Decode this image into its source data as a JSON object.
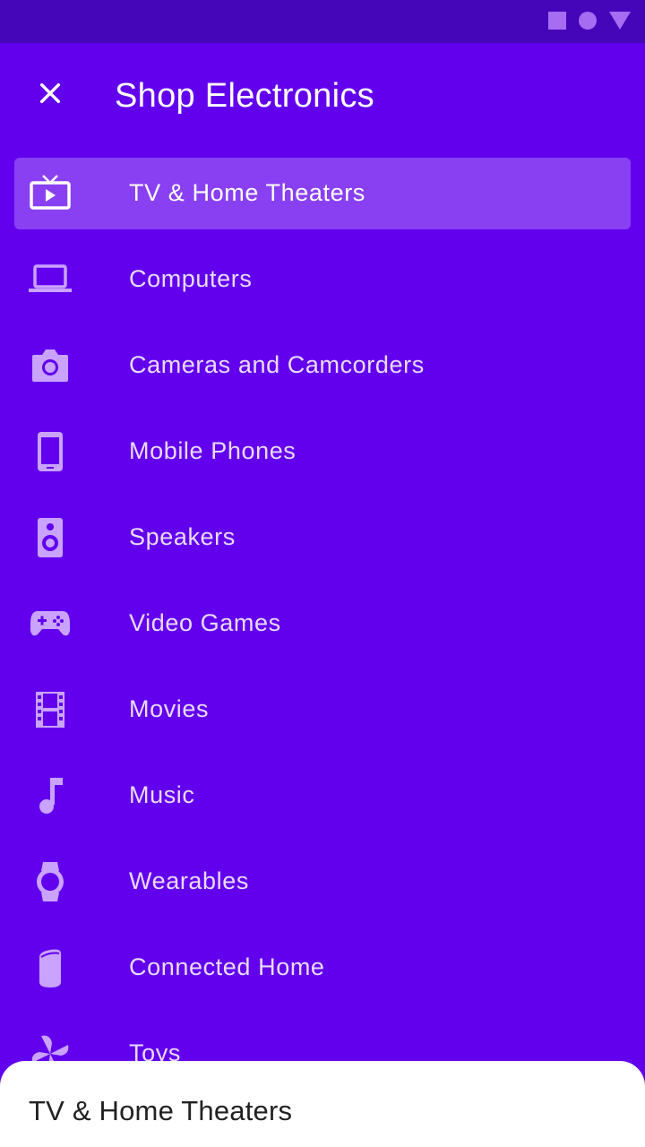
{
  "colors": {
    "primary": "#6200ee",
    "status_bar": "#4406b8",
    "selected_item": "#8940f2",
    "icon": "#c9a3ff",
    "text_on_primary": "#ffffff"
  },
  "status_bar": {
    "icons": [
      "square-icon",
      "circle-icon",
      "triangle-icon"
    ]
  },
  "header": {
    "close_icon": "close-icon",
    "title": "Shop Electronics"
  },
  "menu": {
    "items": [
      {
        "label": "TV & Home Theaters",
        "icon": "tv-icon",
        "selected": true
      },
      {
        "label": "Computers",
        "icon": "laptop-icon",
        "selected": false
      },
      {
        "label": "Cameras and Camcorders",
        "icon": "camera-icon",
        "selected": false
      },
      {
        "label": "Mobile Phones",
        "icon": "phone-icon",
        "selected": false
      },
      {
        "label": "Speakers",
        "icon": "speaker-icon",
        "selected": false
      },
      {
        "label": "Video Games",
        "icon": "gamepad-icon",
        "selected": false
      },
      {
        "label": "Movies",
        "icon": "film-icon",
        "selected": false
      },
      {
        "label": "Music",
        "icon": "music-note-icon",
        "selected": false
      },
      {
        "label": "Wearables",
        "icon": "watch-icon",
        "selected": false
      },
      {
        "label": "Connected Home",
        "icon": "smart-speaker-icon",
        "selected": false
      },
      {
        "label": "Toys",
        "icon": "pinwheel-icon",
        "selected": false
      }
    ]
  },
  "bottom_sheet": {
    "title": "TV & Home Theaters"
  }
}
